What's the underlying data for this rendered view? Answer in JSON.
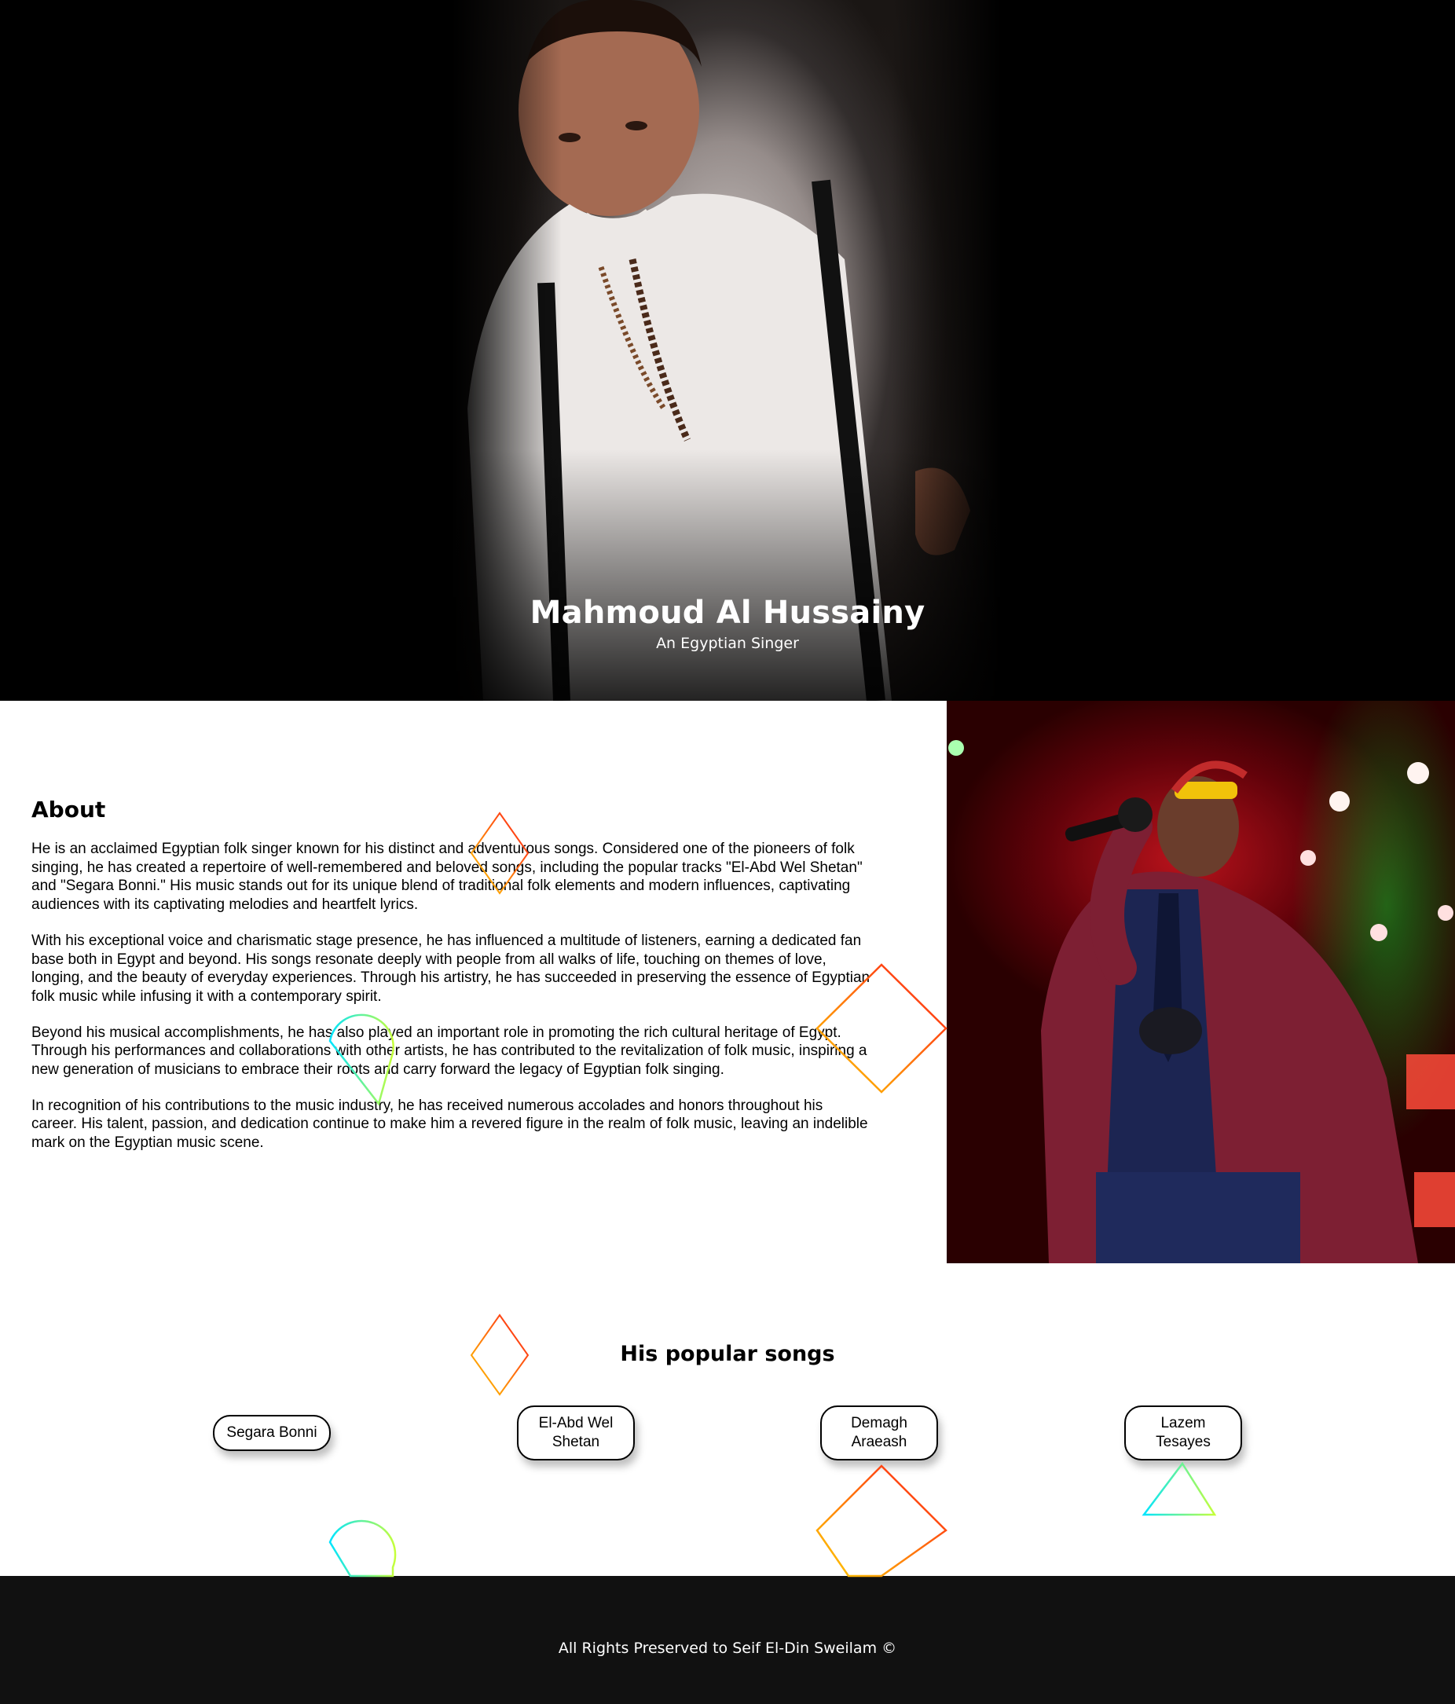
{
  "hero": {
    "name": "Mahmoud Al Hussainy",
    "subtitle": "An Egyptian Singer"
  },
  "about": {
    "heading": "About",
    "paragraphs": [
      "He is an acclaimed Egyptian folk singer known for his distinct and adventurous songs. Considered one of the pioneers of folk singing, he has created a repertoire of well-remembered and beloved songs, including the popular tracks \"El-Abd Wel Shetan\" and \"Segara Bonni.\" His music stands out for its unique blend of traditional folk elements and modern influences, captivating audiences with its captivating melodies and heartfelt lyrics.",
      "With his exceptional voice and charismatic stage presence, he has influenced a multitude of listeners, earning a dedicated fan base both in Egypt and beyond. His songs resonate deeply with people from all walks of life, touching on themes of love, longing, and the beauty of everyday experiences. Through his artistry, he has succeeded in preserving the essence of Egyptian folk music while infusing it with a contemporary spirit.",
      "Beyond his musical accomplishments, he has also played an important role in promoting the rich cultural heritage of Egypt. Through his performances and collaborations with other artists, he has contributed to the revitalization of folk music, inspiring a new generation of musicians to embrace their roots and carry forward the legacy of Egyptian folk singing.",
      "In recognition of his contributions to the music industry, he has received numerous accolades and honors throughout his career. His talent, passion, and dedication continue to make him a revered figure in the realm of folk music, leaving an indelible mark on the Egyptian music scene."
    ]
  },
  "songs": {
    "heading": "His popular songs",
    "items": [
      {
        "label": "Segara Bonni"
      },
      {
        "label": "El-Abd Wel Shetan"
      },
      {
        "label": "Demagh Araeash"
      },
      {
        "label": "Lazem Tesayes"
      }
    ]
  },
  "footer": {
    "text": "All Rights Preserved to Seif El-Din Sweilam ©"
  },
  "colors": {
    "hero_bg": "#000000",
    "footer_bg": "#111111",
    "deco_warm": "#ff1a1a",
    "deco_warm_alt": "#ffcc00",
    "deco_cool": "#00e5ff",
    "deco_cool_alt": "#c6ff3a"
  }
}
